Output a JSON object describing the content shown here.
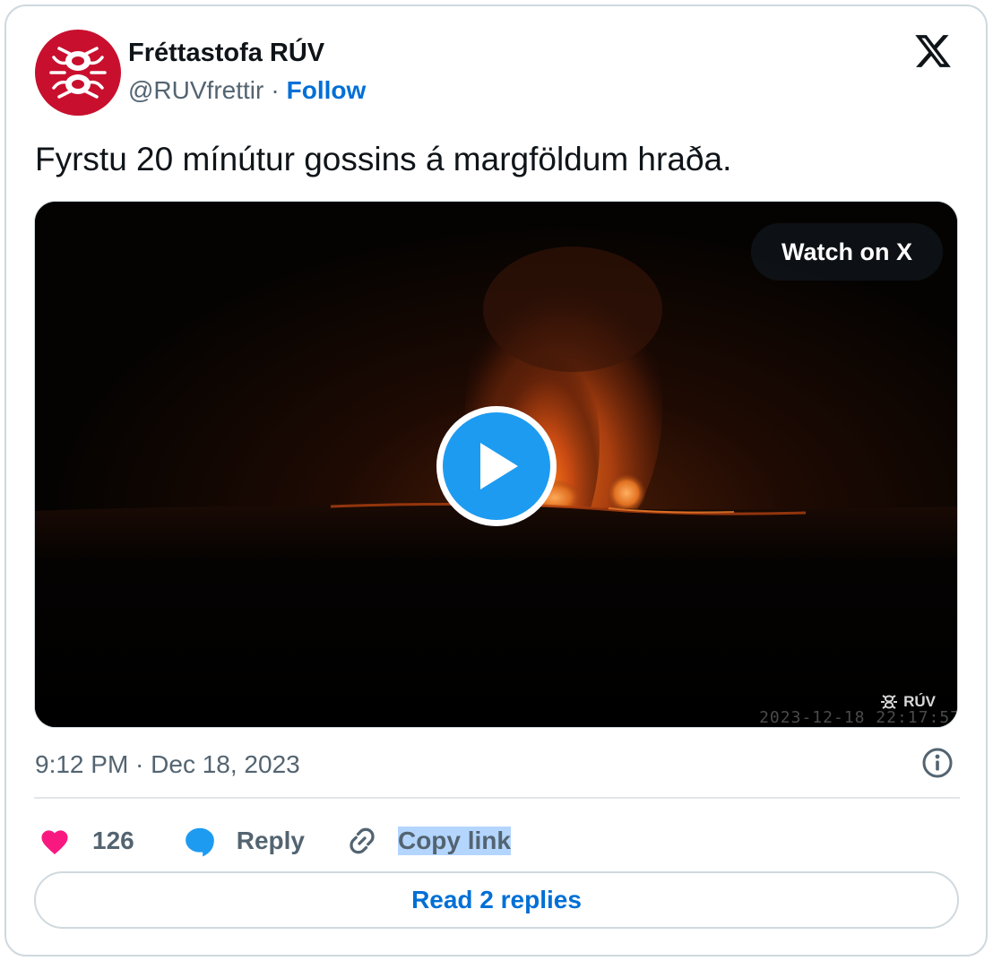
{
  "author": {
    "name": "Fréttastofa RÚV",
    "handle": "@RUVfrettir",
    "separator": "·",
    "follow_label": "Follow"
  },
  "tweet": {
    "text": "Fyrstu 20 mínútur gossins á margföldum hraða.",
    "timestamp": "9:12 PM · Dec 18, 2023"
  },
  "media": {
    "watch_label": "Watch on X",
    "watermark_label": "RÚV",
    "camera_timestamp": "2023-12-18 22:17:57"
  },
  "actions": {
    "like_count": "126",
    "reply_label": "Reply",
    "copy_label": "Copy link"
  },
  "read_replies_label": "Read 2 replies",
  "colors": {
    "brand_red": "#c8102e",
    "link_blue": "#006fd6",
    "play_blue": "#1d9bf0",
    "like_pink": "#f91880",
    "reply_blue": "#1d9bf0",
    "text_gray": "#536471"
  },
  "icons": {
    "logo": "x-logo-icon",
    "play": "play-icon",
    "info": "info-icon",
    "like": "heart-icon",
    "reply": "speech-bubble-icon",
    "copy": "link-icon"
  }
}
